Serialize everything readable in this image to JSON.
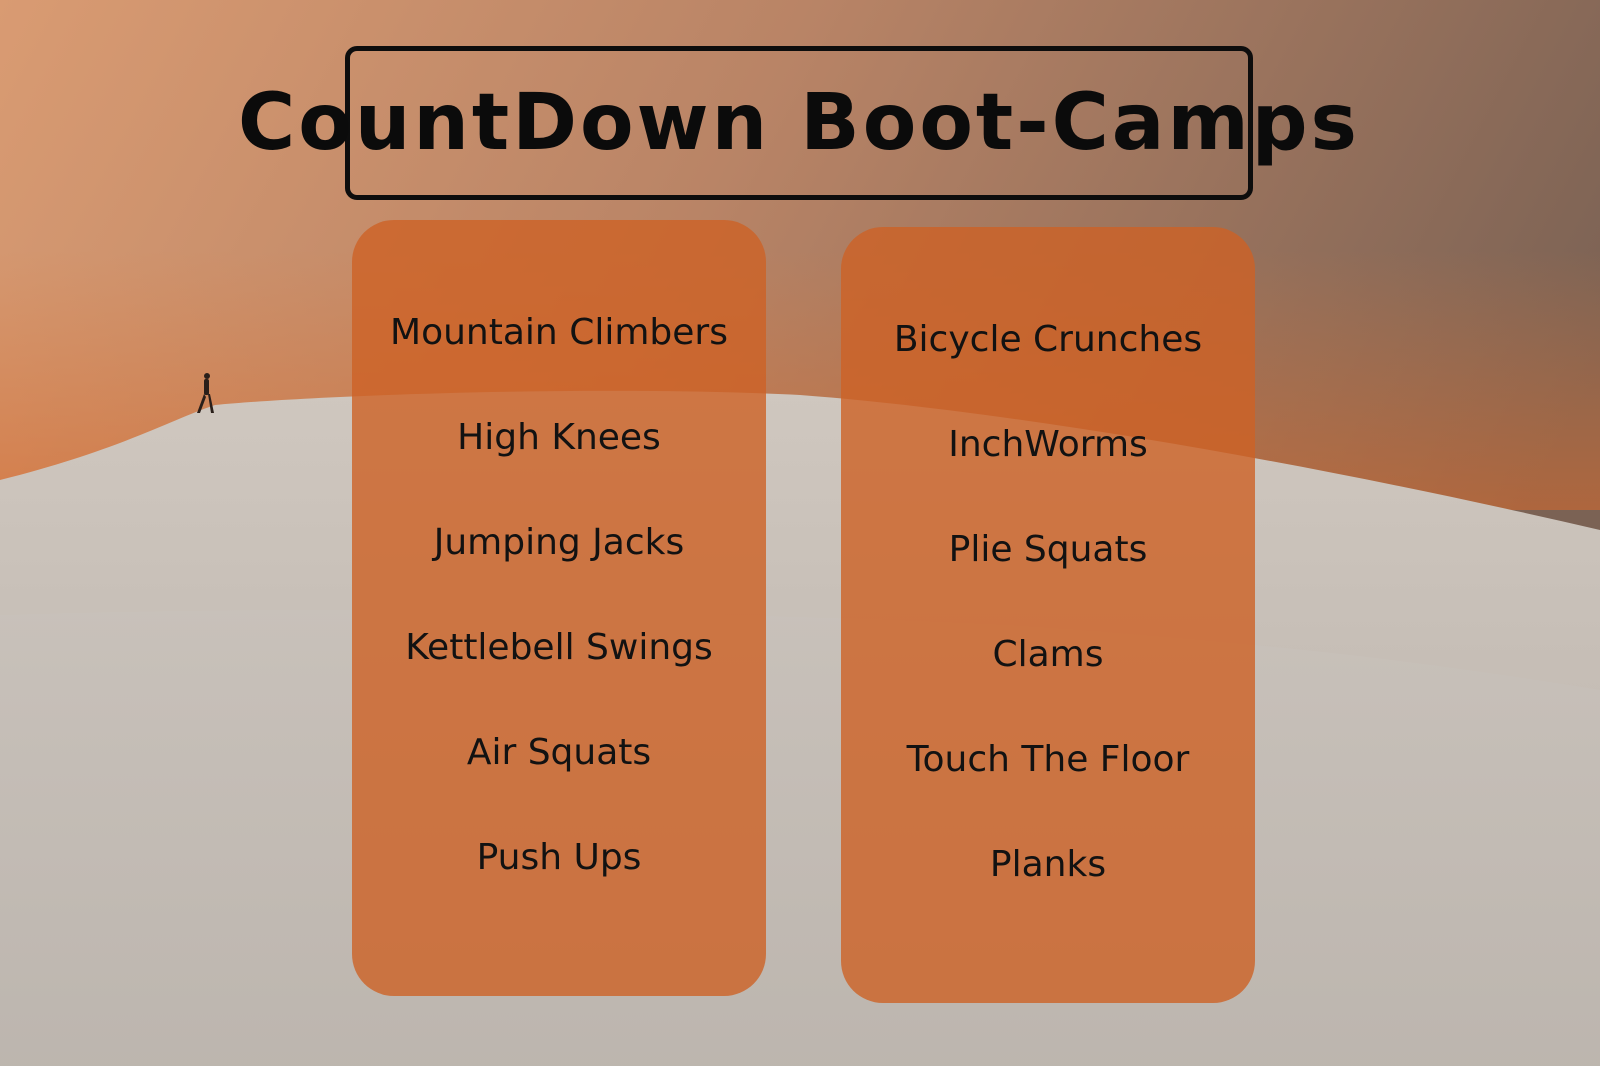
{
  "title": "CountDown Boot-Camps",
  "colors": {
    "panel": "#cd6226",
    "title_border": "#0d0d0d",
    "sky_top_left": "#d99a72",
    "sky_right": "#7e6455",
    "sand": "#c9c2bc"
  },
  "columns": [
    {
      "items": [
        "Mountain Climbers",
        "High Knees",
        "Jumping Jacks",
        "Kettlebell Swings",
        "Air Squats",
        "Push Ups"
      ]
    },
    {
      "items": [
        "Bicycle Crunches",
        "InchWorms",
        "Plie Squats",
        "Clams",
        "Touch The Floor",
        "Planks"
      ]
    }
  ]
}
